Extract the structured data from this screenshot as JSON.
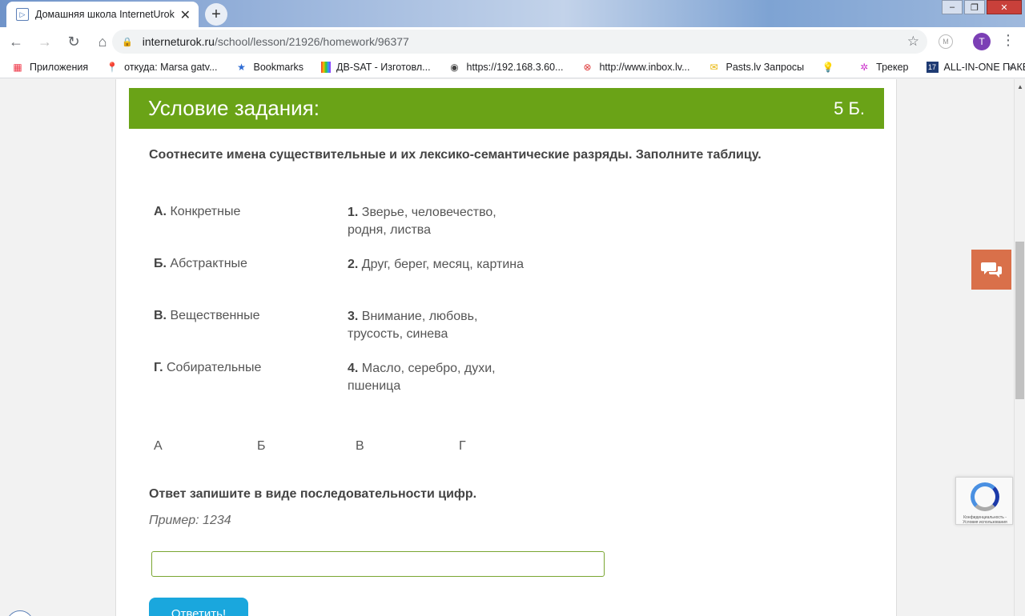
{
  "browser": {
    "tab_title": "Домашняя школа InternetUrok.ru",
    "new_tab_icon": "plus-icon",
    "url_host": "interneturok.ru",
    "url_path": "/school/lesson/21926/homework/96377",
    "avatar_letter": "T",
    "ext_letter": "M"
  },
  "bookmarks": [
    {
      "label": "Приложения",
      "icon": "apps-grid-icon"
    },
    {
      "label": "откуда: Marsa gatv...",
      "icon": "map-pin-icon"
    },
    {
      "label": "Bookmarks",
      "icon": "star-icon"
    },
    {
      "label": "ДВ-SAT - Изготовл...",
      "icon": "color-bars-icon"
    },
    {
      "label": "https://192.168.3.60...",
      "icon": "globe-icon"
    },
    {
      "label": "http://www.inbox.lv...",
      "icon": "inbox-icon"
    },
    {
      "label": "Pasts.lv Запросы",
      "icon": "mail-icon"
    },
    {
      "label": "",
      "icon": "bulb-icon"
    },
    {
      "label": "Трекер",
      "icon": "tracker-icon"
    },
    {
      "label": "ALL-IN-ONE ПАКЕТ...",
      "icon": "calendar-icon"
    }
  ],
  "task": {
    "header_title": "Условие задания:",
    "score": "5 Б.",
    "question": "Соотнесите имена существительные и их лексико-семантические разряды. Заполните таблицу.",
    "left_items": [
      {
        "key": "А.",
        "text": "Конкретные"
      },
      {
        "key": "Б.",
        "text": "Абстрактные"
      },
      {
        "key": "В.",
        "text": "Вещественные"
      },
      {
        "key": "Г.",
        "text": "Собирательные"
      }
    ],
    "right_items": [
      {
        "key": "1.",
        "text": "Зверье, человечество, родня, листва"
      },
      {
        "key": "2.",
        "text": "Друг, берег, месяц, картина"
      },
      {
        "key": "3.",
        "text": "Внимание, любовь, трусость, синева"
      },
      {
        "key": "4.",
        "text": "Масло, серебро, духи, пшеница"
      }
    ],
    "answer_letters": [
      "А",
      "Б",
      "В",
      "Г"
    ],
    "hint": "Ответ запишите в виде последовательности цифр.",
    "example": "Пример: 1234",
    "answer_value": "",
    "submit_label": "Ответить!"
  },
  "recaptcha_text": "Конфиденциальность - Условия использования",
  "colors": {
    "header_green": "#6aa317",
    "submit_blue": "#1aa7dd",
    "chat_orange": "#d9704a"
  }
}
